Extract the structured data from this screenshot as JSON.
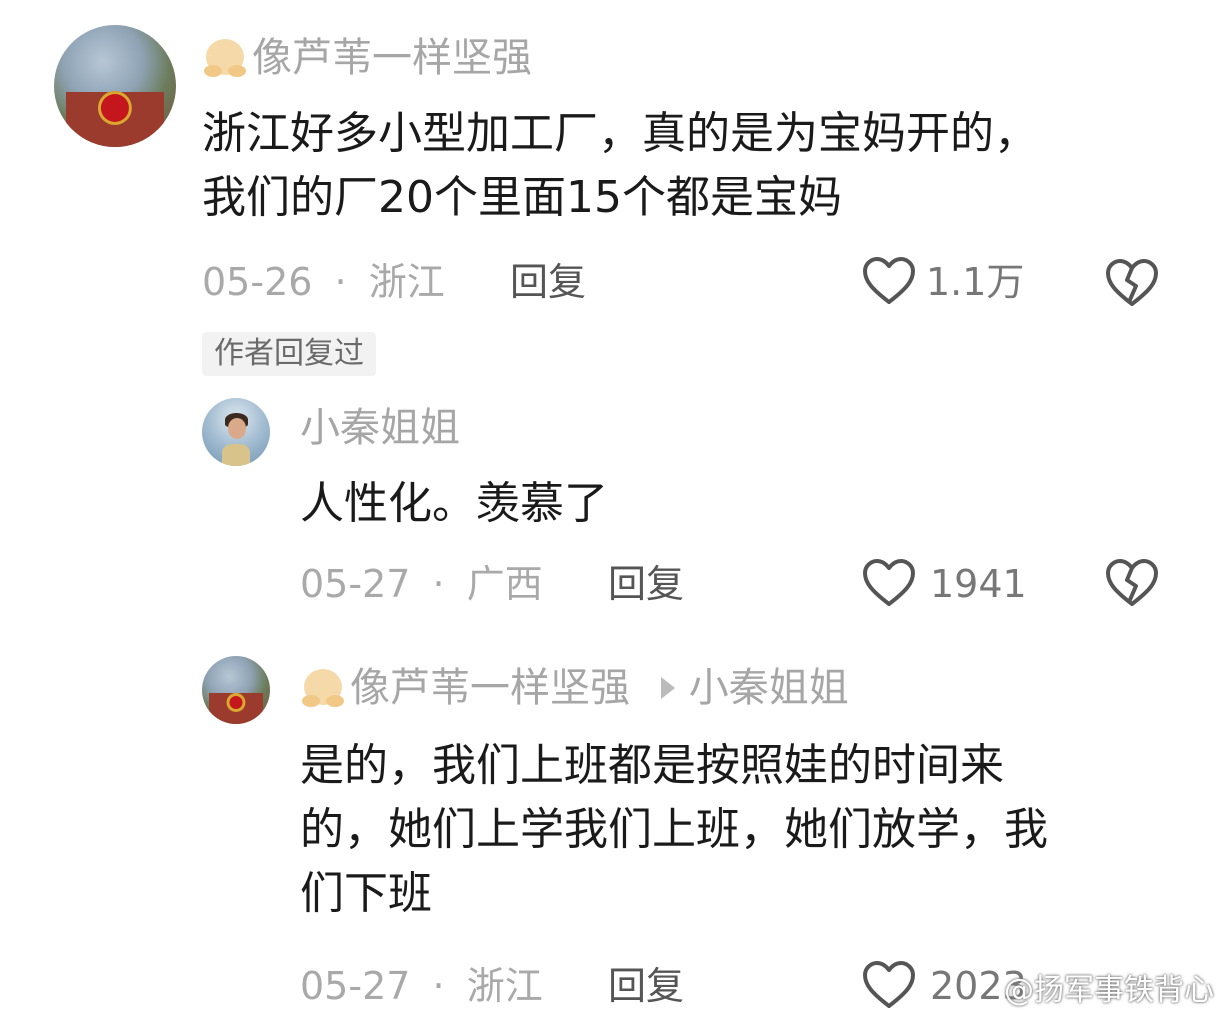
{
  "comments": [
    {
      "username": "像芦苇一样坚强",
      "text_line1": "浙江好多小型加工厂，真的是为宝妈开的，",
      "text_line2": "我们的厂20个里面15个都是宝妈",
      "date": "05-26",
      "separator": "·",
      "location": "浙江",
      "reply_label": "回复",
      "likes": "1.1万",
      "badge": "作者回复过"
    },
    {
      "username": "小秦姐姐",
      "text": "人性化。羡慕了",
      "date": "05-27",
      "separator": "·",
      "location": "广西",
      "reply_label": "回复",
      "likes": "1941"
    },
    {
      "username": "像芦苇一样坚强",
      "reply_to": "小秦姐姐",
      "text_line1": "是的，我们上班都是按照娃的时间来",
      "text_line2": "的，她们上学我们上班，她们放学，我",
      "text_line3": "们下班",
      "date": "05-27",
      "separator": "·",
      "location": "浙江",
      "reply_label": "回复",
      "likes": "2023"
    }
  ],
  "icons": {
    "like": "heart-outline-icon",
    "dislike": "broken-heart-icon",
    "emoji": "hugging-face-emoji",
    "arrow": "play-arrow-icon"
  },
  "watermark": "@扬军事铁背心"
}
